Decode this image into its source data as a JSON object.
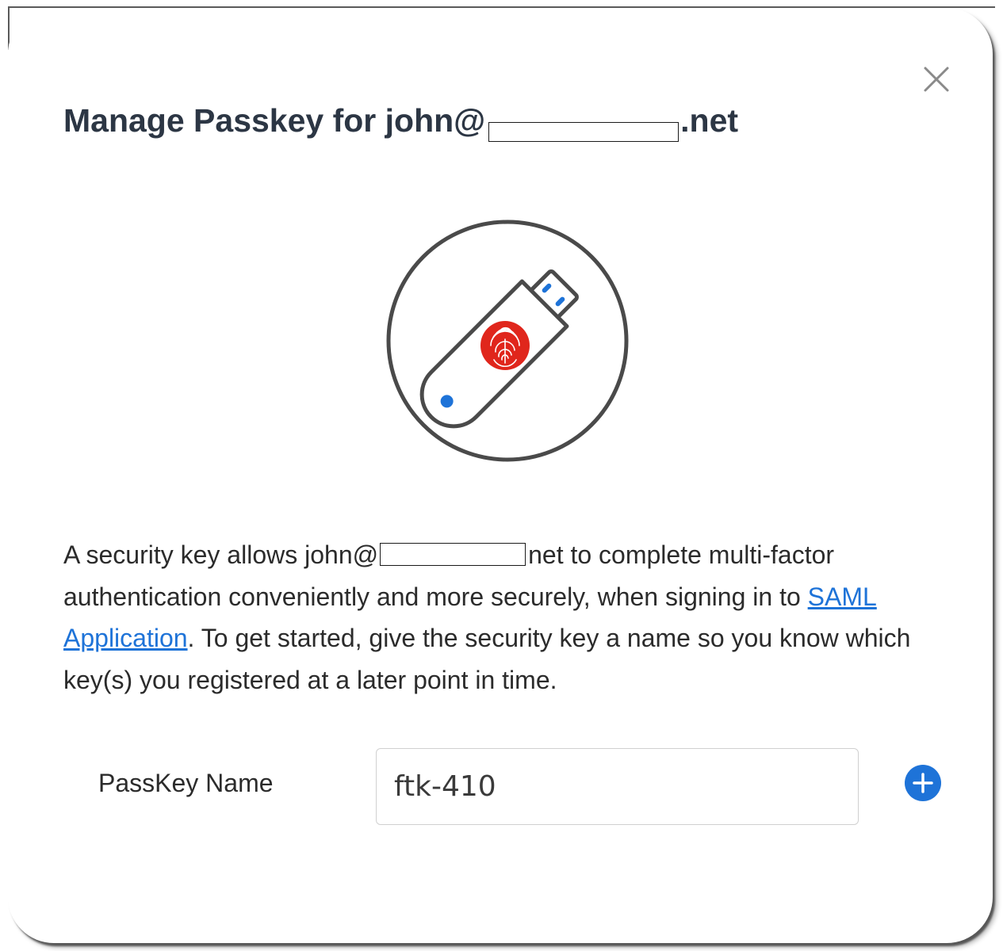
{
  "dialog": {
    "title_prefix": "Manage Passkey for john@",
    "title_suffix": ".net",
    "description": {
      "part1": "A security key allows john@",
      "part2": "net to complete multi-factor authentication conveniently and more securely, when signing in to ",
      "link_text": "SAML Application",
      "part3": ". To get started, give the security key a name so you know which key(s) you registered at a later point in time."
    },
    "passkey_field": {
      "label": "PassKey Name",
      "value": "ftk-410"
    }
  },
  "icons": {
    "close": "close-icon",
    "illustration": "security-key-icon",
    "fingerprint": "fingerprint-icon",
    "add": "plus-circle-icon"
  },
  "colors": {
    "title": "#2c3644",
    "link": "#1e73d8",
    "accent_blue": "#1e73d8",
    "fingerprint_red": "#e0261c",
    "icon_stroke": "#4a4a4a"
  }
}
